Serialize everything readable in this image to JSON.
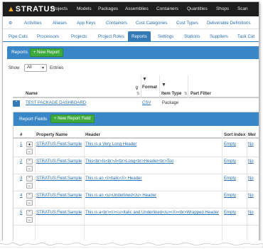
{
  "logo": "STRATUS",
  "topnav": [
    "Projects",
    "Models",
    "Packages",
    "Assemblies",
    "Containers",
    "Quantities",
    "Shops",
    "Scan"
  ],
  "row1": {
    "items": [
      "Activities",
      "Aliases",
      "App Keys",
      "Containers",
      "Cost Categories",
      "Cost Types",
      "Deliverable Definitions"
    ]
  },
  "tabs": [
    "Pipe Cuts",
    "Processors",
    "Projects",
    "Project Roles",
    "Reports",
    "Settings",
    "Stations",
    "Suppliers",
    "Task Cat"
  ],
  "active_tab": "Reports",
  "reports": {
    "title": "Reports",
    "new_button": "+ New Report",
    "show_label": "Show",
    "show_value": "All",
    "entries_label": "Entries",
    "columns": {
      "name": "Name",
      "format": "Format",
      "item_type": "Item Type",
      "part_filter": "Part Filter"
    },
    "row": {
      "name": "TEST PACKAGE DASHBOARD",
      "format": "CSV",
      "item_type": "Package"
    }
  },
  "report_fields": {
    "title": "Report Fields",
    "new_button": "+ New Report Field",
    "columns": {
      "num": "#",
      "property_name": "Property Name",
      "header": "Header",
      "sort_index": "Sort Index",
      "more": "Mer"
    },
    "rows": [
      {
        "num": "1",
        "property": "STRATUS.Field.Sample",
        "header": "This is a Very Long Header",
        "sort": "Empty",
        "more": "No"
      },
      {
        "num": "2",
        "property": "STRATUS.Field.Sample",
        "header": "This<br>Is<br>A<br>Long<br>Header<br>Too",
        "sort": "Empty",
        "more": "No"
      },
      {
        "num": "3",
        "property": "STRATUS.Field.Sample",
        "header": "This is an <i>Italic</i> Header",
        "sort": "Empty",
        "more": "No"
      },
      {
        "num": "4",
        "property": "STRATUS.Field.Sample",
        "header": "This is an <u>Underlined</u> Header",
        "sort": "Empty",
        "more": "No"
      },
      {
        "num": "5",
        "property": "STRATUS.Field.Sample",
        "header": "This is a<br><i><u>Italic and Underlined</u></i><br>Wrapped Header",
        "sort": "Empty",
        "more": "No"
      }
    ]
  }
}
